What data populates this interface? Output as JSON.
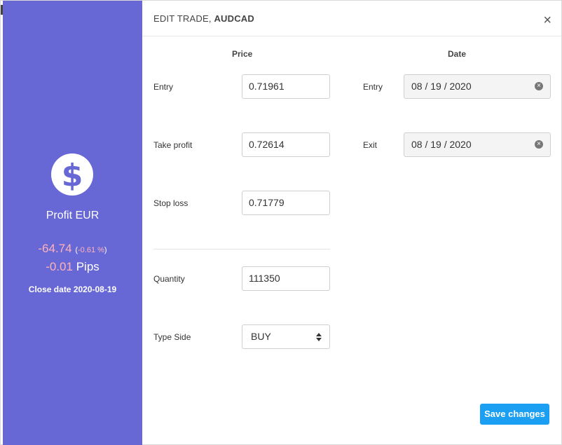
{
  "sidebar": {
    "profit_label": "Profit EUR",
    "profit_value": "-64.74",
    "profit_pct_open": "(",
    "profit_pct": "-0.61 %",
    "profit_pct_close": ")",
    "pips_value": "-0.01",
    "pips_label": "Pips",
    "close_date": "Close date 2020-08-19",
    "icon": "dollar-icon"
  },
  "header": {
    "title_prefix": "EDIT TRADE, ",
    "symbol": "AUDCAD",
    "close_symbol": "×"
  },
  "form": {
    "price_heading": "Price",
    "date_heading": "Date",
    "entry_label": "Entry",
    "entry_price": "0.71961",
    "take_profit_label": "Take profit",
    "take_profit": "0.72614",
    "stop_loss_label": "Stop loss",
    "stop_loss": "0.71779",
    "quantity_label": "Quantity",
    "quantity": "111350",
    "type_side_label": "Type Side",
    "type_side": "BUY",
    "entry_date_label": "Entry",
    "entry_date": "08 / 19 / 2020",
    "exit_date_label": "Exit",
    "exit_date": "08 / 19 / 2020"
  },
  "footer": {
    "save_label": "Save changes"
  },
  "colors": {
    "sidebar_bg": "#6767d6",
    "negative": "#ffb3b8",
    "primary_button": "#1a9ff2"
  }
}
